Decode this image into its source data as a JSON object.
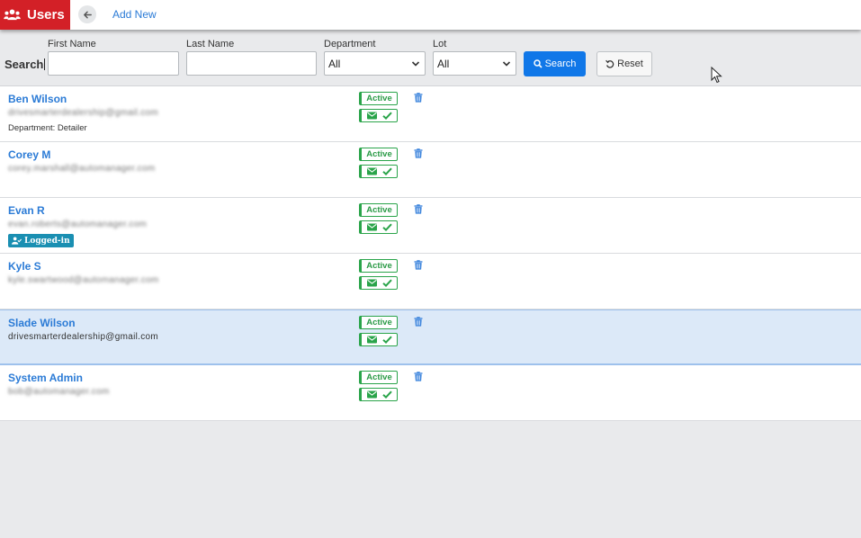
{
  "header": {
    "title": "Users",
    "add_new_label": "Add New"
  },
  "search": {
    "label": "Search",
    "first_name_label": "First Name",
    "first_name_value": "",
    "last_name_label": "Last Name",
    "last_name_value": "",
    "department_label": "Department",
    "department_value": "All",
    "lot_label": "Lot",
    "lot_value": "All",
    "search_button": "Search",
    "reset_button": "Reset"
  },
  "colors": {
    "brand": "#d32027",
    "primary": "#1077e8",
    "active_green": "#2aa44a",
    "link_blue": "#2b7bd6",
    "logged_in_badge": "#1a8fb2"
  },
  "users": [
    {
      "name": "Ben Wilson",
      "email": "drivesmarterdealership@gmail.com",
      "email_obscured": true,
      "department": "Department: Detailer",
      "status": "Active",
      "logged_in": ""
    },
    {
      "name": "Corey M",
      "email": "corey.marshall@automanager.com",
      "email_obscured": true,
      "department": "",
      "status": "Active",
      "logged_in": ""
    },
    {
      "name": "Evan R",
      "email": "evan.roberts@automanager.com",
      "email_obscured": true,
      "department": "",
      "status": "Active",
      "logged_in": "Logged-in"
    },
    {
      "name": "Kyle S",
      "email": "kyle.swartwood@automanager.com",
      "email_obscured": true,
      "department": "",
      "status": "Active",
      "logged_in": ""
    },
    {
      "name": "Slade Wilson",
      "email": "drivesmarterdealership@gmail.com",
      "email_obscured": false,
      "department": "",
      "status": "Active",
      "logged_in": "",
      "selected": true
    },
    {
      "name": "System Admin",
      "email": "bob@automanager.com",
      "email_obscured": true,
      "department": "",
      "status": "Active",
      "logged_in": ""
    }
  ]
}
